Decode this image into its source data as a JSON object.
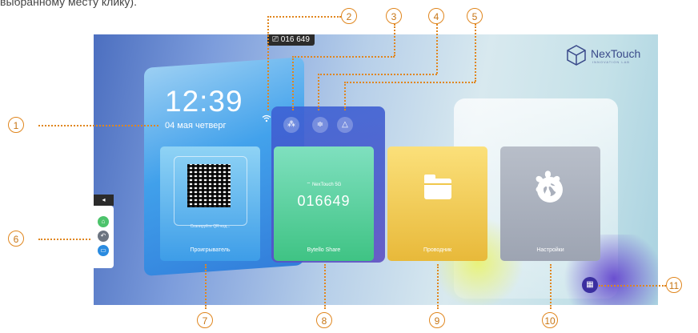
{
  "header_text": "выбранному месту клику).",
  "screen": {
    "id_badge": "016 649",
    "clock": "12:39",
    "date": "04 мая  четверг",
    "quick_icons": [
      "wifi-icon",
      "share-nodes-icon",
      "sliders-icon",
      "triangle-warning-icon"
    ],
    "tiles": [
      {
        "label": "Проигрыватель",
        "subtext": "Сканируйте QR-код..."
      },
      {
        "label": "Bytello Share",
        "network": "NexTouch 5G",
        "code": "016649"
      },
      {
        "label": "Проводник"
      },
      {
        "label": "Настройки"
      }
    ],
    "logo": {
      "name": "NexTouch",
      "tagline": "INNOVATION LAB"
    },
    "sidebar": {
      "toggle": "◂"
    }
  },
  "callouts": [
    "1",
    "2",
    "3",
    "4",
    "5",
    "6",
    "7",
    "8",
    "9",
    "10",
    "11"
  ],
  "colors": {
    "accent": "#e0861e",
    "callout_text": "#c77514"
  }
}
